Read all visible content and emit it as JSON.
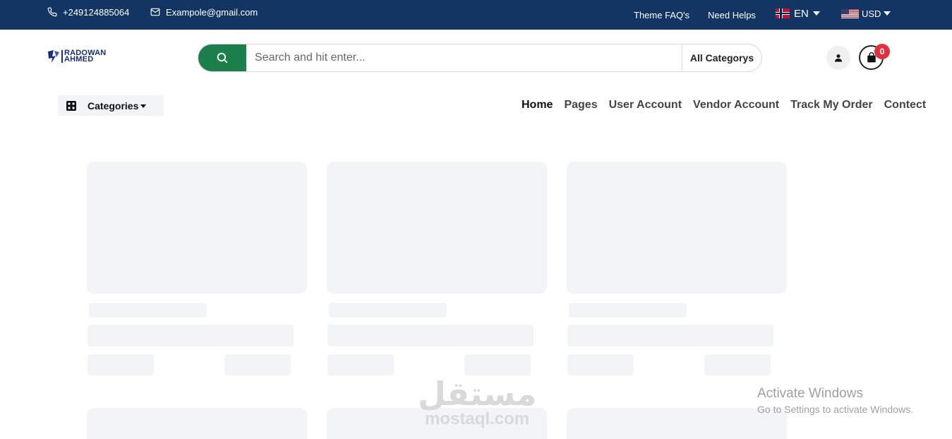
{
  "topbar": {
    "phone": "+249124885064",
    "email": "Exampole@gmail.com",
    "faq": "Theme FAQ's",
    "help": "Need Helps",
    "language": "EN",
    "currency": "USD",
    "bg_color": "#133563"
  },
  "logo": {
    "line1": "RADOWAN",
    "line2": "AHMED"
  },
  "search": {
    "placeholder": "Search and hit enter...",
    "category": "All Categorys",
    "button_color": "#1a7f4a"
  },
  "cart": {
    "count": "0"
  },
  "categories_button": "Categories",
  "nav": [
    "Home",
    "Pages",
    "User Account",
    "Vendor Account",
    "Track My Order",
    "Contect"
  ],
  "watermark": {
    "arabic": "مستقل",
    "latin": "mostaql.com"
  },
  "windows_notice": {
    "title": "Activate Windows",
    "subtitle": "Go to Settings to activate Windows."
  }
}
